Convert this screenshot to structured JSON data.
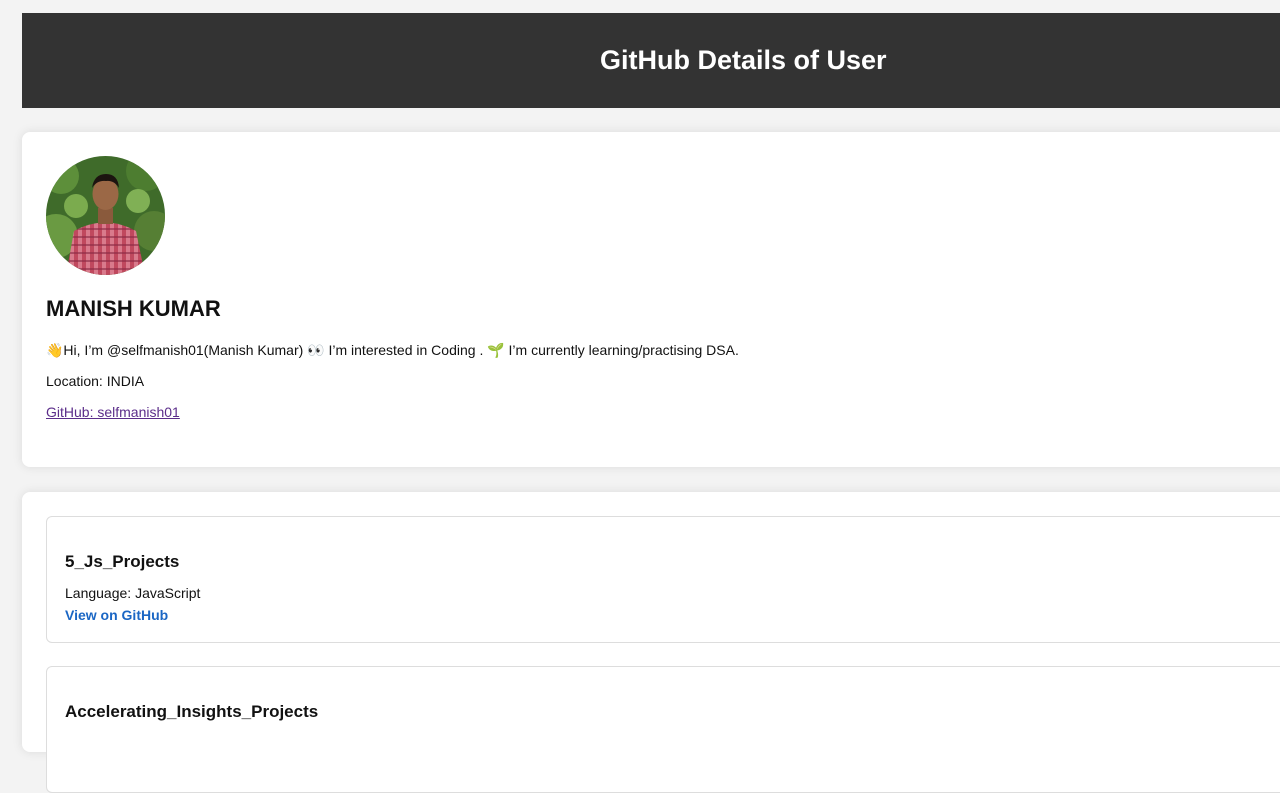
{
  "header": {
    "title": "GitHub Details of User",
    "background": "#333333"
  },
  "profile": {
    "avatar_icon": "user-avatar-photo",
    "name": "MANISH KUMAR",
    "bio": "👋Hi, I’m @selfmanish01(Manish Kumar) 👀 I’m interested in Coding . 🌱 I’m currently learning/practising DSA.",
    "location": "Location: INDIA",
    "github_link": "GitHub: selfmanish01"
  },
  "repos": [
    {
      "name": "5_Js_Projects",
      "language": "Language: JavaScript",
      "link": "View on GitHub"
    },
    {
      "name": "Accelerating_Insights_Projects",
      "language": "",
      "link": ""
    }
  ],
  "colors": {
    "link_visited": "#5b2d8a",
    "link_repo": "#1a66c4"
  }
}
